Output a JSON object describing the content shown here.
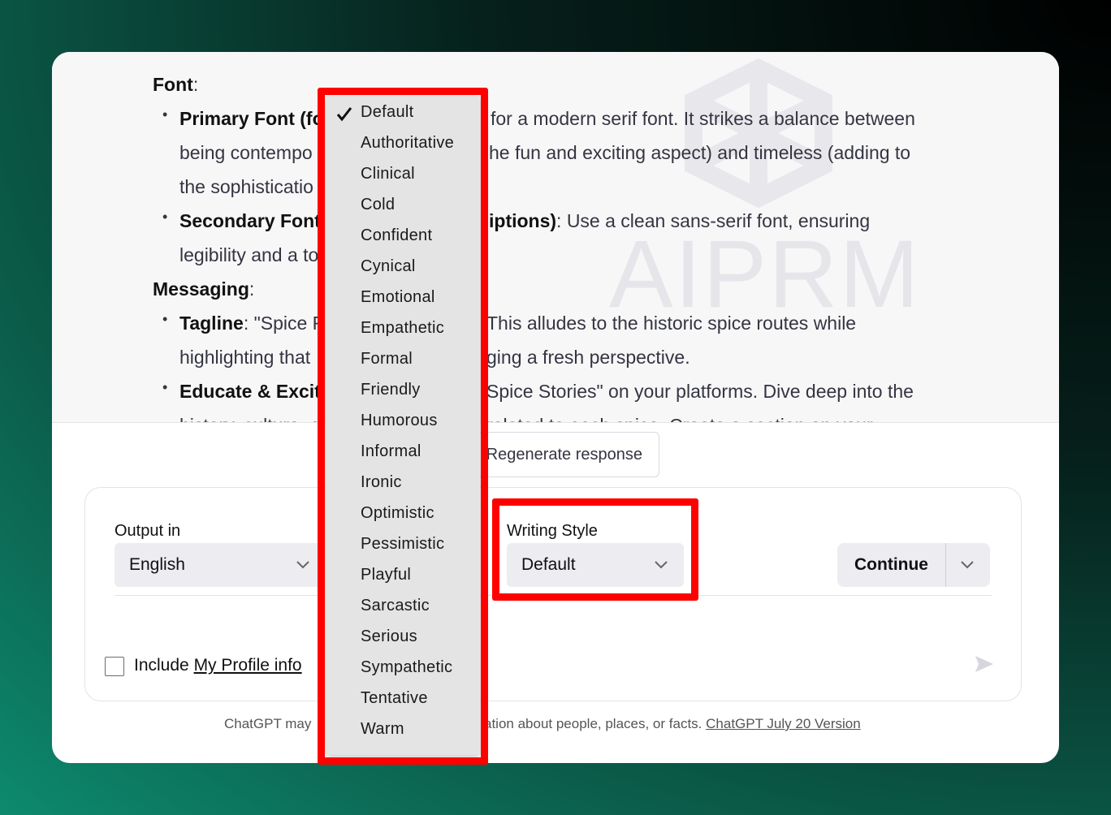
{
  "chat": {
    "font_heading": "Font",
    "font_colon": ":",
    "primary_font_bold": "Primary Font (fo",
    "primary_font_tail": "for a modern serif font. It strikes a balance between",
    "line2_left": "being contempo",
    "line2_right": "he fun and exciting aspect) and timeless (adding to",
    "line3_left": "the sophisticatio",
    "secondary_font_bold": "Secondary Font",
    "secondary_font_mid": "iptions)",
    "secondary_font_tail": ": Use a clean sans-serif font, ensuring",
    "line5_left": "legibility and a to",
    "messaging_heading": "Messaging",
    "messaging_colon": ":",
    "tagline_bold": "Tagline",
    "tagline_left": ": \"Spice F",
    "tagline_right": "This alludes to the historic spice routes while",
    "line8_left": "highlighting that",
    "line8_right": "ging a fresh perspective.",
    "educate_bold": "Educate & Excit",
    "educate_right": "Spice Stories\" on your platforms. Dive deep into the",
    "line10_left": "history, culture, a",
    "line10_right": "related to each spice. Create a section on your",
    "bullet_char": "•",
    "watermark": "AIPRM"
  },
  "regenerate_label": "Regenerate response",
  "controls": {
    "output_label": "Output in",
    "output_value": "English",
    "writing_style_label": "Writing Style",
    "writing_style_value": "Default",
    "continue_label": "Continue",
    "include_prefix": "Include ",
    "include_link": "My Profile info"
  },
  "footer": {
    "left": "ChatGPT may",
    "right": "ation about people, places, or facts.",
    "version_link": "ChatGPT July 20 Version"
  },
  "writing_style_options": [
    "Default",
    "Authoritative",
    "Clinical",
    "Cold",
    "Confident",
    "Cynical",
    "Emotional",
    "Empathetic",
    "Formal",
    "Friendly",
    "Humorous",
    "Informal",
    "Ironic",
    "Optimistic",
    "Pessimistic",
    "Playful",
    "Sarcastic",
    "Serious",
    "Sympathetic",
    "Tentative",
    "Warm"
  ],
  "selected_option": "Default",
  "colors": {
    "highlight_red": "#ff0000",
    "accent_bg": "#ececf1"
  },
  "icons": [
    "checkmark-icon",
    "chevron-down-icon",
    "send-icon",
    "aiprm-logo"
  ]
}
